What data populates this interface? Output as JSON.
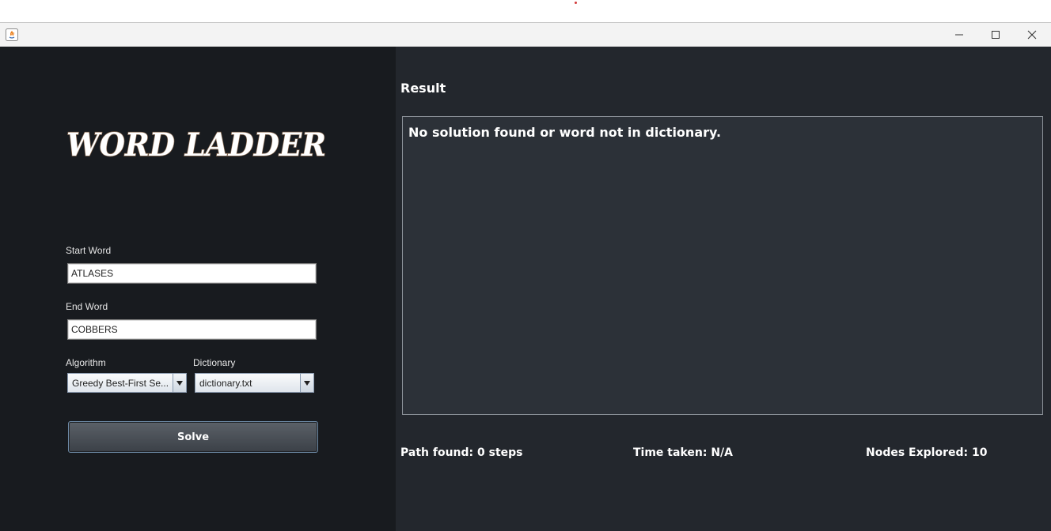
{
  "window": {
    "controls": {
      "minimize_icon": "minimize-icon",
      "maximize_icon": "maximize-icon",
      "close_icon": "close-icon"
    }
  },
  "app": {
    "logo_text": "WORD LADDER"
  },
  "form": {
    "start_word": {
      "label": "Start Word",
      "value": "ATLASES"
    },
    "end_word": {
      "label": "End Word",
      "value": "COBBERS"
    },
    "algorithm": {
      "label": "Algorithm",
      "selected": "Greedy Best-First Se..."
    },
    "dictionary": {
      "label": "Dictionary",
      "selected": "dictionary.txt"
    },
    "solve_label": "Solve"
  },
  "result": {
    "title": "Result",
    "message": "No solution found or word not in dictionary."
  },
  "stats": {
    "path_found": "Path found: 0 steps",
    "time_taken": "Time taken: N/A",
    "nodes_explored": "Nodes Explored: 10"
  },
  "colors": {
    "left_panel_bg": "#181b1f",
    "right_panel_bg": "#23272d",
    "result_area_bg": "#2c3138",
    "accent_border": "#6d8aa6"
  }
}
